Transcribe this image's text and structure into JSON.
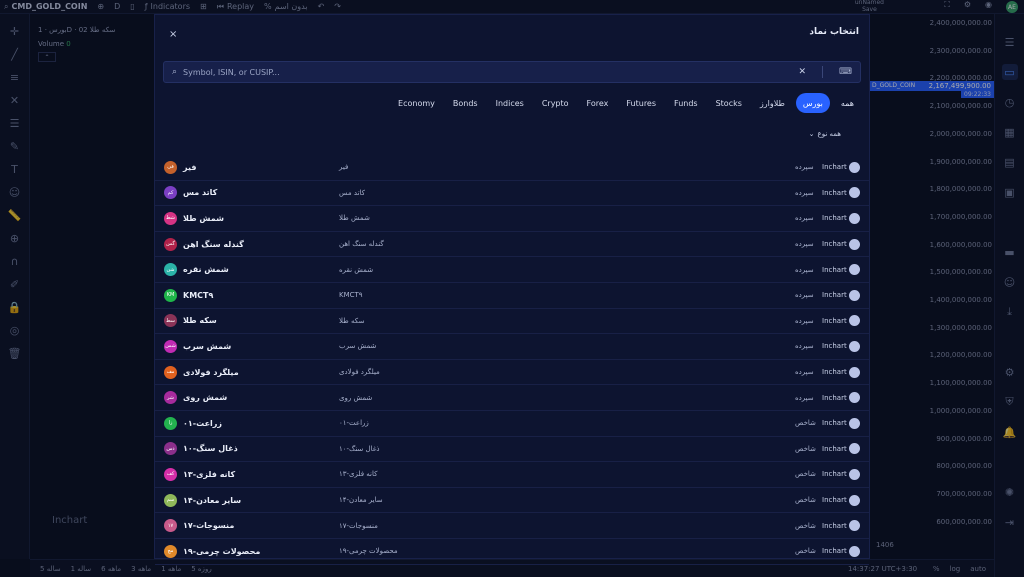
{
  "topbar": {
    "symbol": "CMD_GOLD_COIN",
    "interval": "D",
    "indicators": "Indicators",
    "replay": "Replay",
    "layout_label": "بدون اسم",
    "user_name": "unNamed",
    "user_status": "Save",
    "avatar": "AE"
  },
  "legend": {
    "title": "بورس · 1D · سکه طلا",
    "volume_label": "Volume",
    "volume_value": "0",
    "series_value": "02"
  },
  "watermark": "Inchart",
  "price_scale": [
    "2,400,000,000.00",
    "2,300,000,000.00",
    "2,200,000,000.00",
    "2,100,000,000.00",
    "2,000,000,000.00",
    "1,900,000,000.00",
    "1,800,000,000.00",
    "1,700,000,000.00",
    "1,600,000,000.00",
    "1,500,000,000.00",
    "1,400,000,000.00",
    "1,300,000,000.00",
    "1,200,000,000.00",
    "1,100,000,000.00",
    "1,000,000,000.00",
    "900,000,000.00",
    "800,000,000.00",
    "700,000,000.00",
    "600,000,000.00"
  ],
  "last_price": "2,167,499,900.00",
  "last_price_countdown": "09:22:33",
  "last_price_tag": "D_GOLD_COIN",
  "year_label": "1406",
  "bottombar": {
    "timeframes": [
      "5 ساله",
      "1 ساله",
      "6 ماهه",
      "3 ماهه",
      "1 ماهه",
      "5 روزه"
    ],
    "time": "14:37:27 UTC+3:30",
    "pct": "%",
    "log": "log",
    "auto": "auto"
  },
  "modal": {
    "title": "انتخاب نماد",
    "close": "×",
    "search_placeholder": "Symbol, ISIN, or CUSIP...",
    "categories": [
      {
        "label": "همه",
        "active": false
      },
      {
        "label": "بورس",
        "active": true
      },
      {
        "label": "طلاوارز",
        "active": false
      },
      {
        "label": "Stocks",
        "active": false
      },
      {
        "label": "Funds",
        "active": false
      },
      {
        "label": "Futures",
        "active": false
      },
      {
        "label": "Forex",
        "active": false
      },
      {
        "label": "Crypto",
        "active": false
      },
      {
        "label": "Indices",
        "active": false
      },
      {
        "label": "Bonds",
        "active": false
      },
      {
        "label": "Economy",
        "active": false
      }
    ],
    "type_filter": "همه نوع",
    "rows": [
      {
        "name": "فیر",
        "badge": "فی",
        "color": "#c4612b",
        "desc": "فیر",
        "type": "سپرده",
        "exchange": "Inchart"
      },
      {
        "name": "کاتد مس",
        "badge": "کم",
        "color": "#7b3fc4",
        "desc": "کاتد مس",
        "type": "سپرده",
        "exchange": "Inchart"
      },
      {
        "name": "شمش طلا",
        "badge": "شط",
        "color": "#d63384",
        "desc": "شمش طلا",
        "type": "سپرده",
        "exchange": "Inchart"
      },
      {
        "name": "گندله سنگ اهن",
        "badge": "گس",
        "color": "#b0224a",
        "desc": "گندله سنگ اهن",
        "type": "سپرده",
        "exchange": "Inchart"
      },
      {
        "name": "شمش نقره",
        "badge": "شن",
        "color": "#2bb3a8",
        "desc": "شمش نقره",
        "type": "سپرده",
        "exchange": "Inchart"
      },
      {
        "name": "KMCT۹",
        "badge": "KM",
        "color": "#1fb54a",
        "desc": "KMCT۹",
        "type": "سپرده",
        "exchange": "Inchart"
      },
      {
        "name": "سکه طلا",
        "badge": "سط",
        "color": "#8a3357",
        "desc": "سکه طلا",
        "type": "سپرده",
        "exchange": "Inchart"
      },
      {
        "name": "شمش سرب",
        "badge": "شس",
        "color": "#c02bb3",
        "desc": "شمش سرب",
        "type": "سپرده",
        "exchange": "Inchart"
      },
      {
        "name": "میلگرد فولادی",
        "badge": "مف",
        "color": "#e0611f",
        "desc": "میلگرد فولادی",
        "type": "سپرده",
        "exchange": "Inchart"
      },
      {
        "name": "شمش روی",
        "badge": "شر",
        "color": "#a72b9d",
        "desc": "شمش روی",
        "type": "سپرده",
        "exchange": "Inchart"
      },
      {
        "name": "۰۱-زراعت",
        "badge": "زا",
        "color": "#23b24f",
        "desc": "زراعت-۰۱",
        "type": "شاخص",
        "exchange": "Inchart"
      },
      {
        "name": "۱۰-ذغال سنگ",
        "badge": "ذس",
        "color": "#8b2f8b",
        "desc": "ذغال سنگ-۱۰",
        "type": "شاخص",
        "exchange": "Inchart"
      },
      {
        "name": "۱۳-کانه فلزی",
        "badge": "کف",
        "color": "#d42ea8",
        "desc": "کانه فلزی-۱۳",
        "type": "شاخص",
        "exchange": "Inchart"
      },
      {
        "name": "۱۴-سایر معادن",
        "badge": "سم",
        "color": "#8fb85a",
        "desc": "سایر معادن-۱۴",
        "type": "شاخص",
        "exchange": "Inchart"
      },
      {
        "name": "۱۷-منسوجات",
        "badge": "۱۷",
        "color": "#c85a8a",
        "desc": "منسوجات-۱۷",
        "type": "شاخص",
        "exchange": "Inchart"
      },
      {
        "name": "۱۹-محصولات چرمی",
        "badge": "مچ",
        "color": "#e0892a",
        "desc": "محصولات چرمی-۱۹",
        "type": "شاخص",
        "exchange": "Inchart"
      }
    ]
  }
}
